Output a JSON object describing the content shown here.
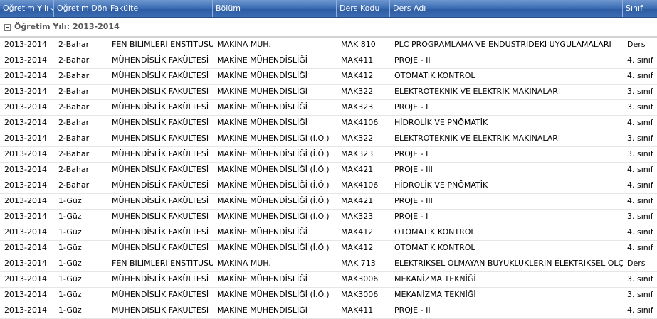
{
  "columns": [
    "Öğretim Yılı",
    "Öğretim Döne",
    "Fakülte",
    "Bölüm",
    "Ders Kodu",
    "Ders Adı",
    "Sınıf"
  ],
  "group_label": "Öğretim Yılı: 2013-2014",
  "rows": [
    [
      "2013-2014",
      "2-Bahar",
      "FEN BİLİMLERİ ENSTİTÜSÜ",
      "MAKİNA MÜH.",
      "MAK 810",
      "PLC PROGRAMLAMA VE ENDÜSTRİDEKİ UYGULAMALARI",
      "Ders"
    ],
    [
      "2013-2014",
      "2-Bahar",
      "MÜHENDİSLİK FAKÜLTESİ",
      "MAKİNE MÜHENDİSLİĞİ",
      "MAK411",
      "PROJE - II",
      "4. sınıf"
    ],
    [
      "2013-2014",
      "2-Bahar",
      "MÜHENDİSLİK FAKÜLTESİ",
      "MAKİNE MÜHENDİSLİĞİ",
      "MAK412",
      "OTOMATİK KONTROL",
      "4. sınıf"
    ],
    [
      "2013-2014",
      "2-Bahar",
      "MÜHENDİSLİK FAKÜLTESİ",
      "MAKİNE MÜHENDİSLİĞİ",
      "MAK322",
      "ELEKTROTEKNİK VE ELEKTRİK MAKİNALARI",
      "3. sınıf"
    ],
    [
      "2013-2014",
      "2-Bahar",
      "MÜHENDİSLİK FAKÜLTESİ",
      "MAKİNE MÜHENDİSLİĞİ",
      "MAK323",
      "PROJE - I",
      "3. sınıf"
    ],
    [
      "2013-2014",
      "2-Bahar",
      "MÜHENDİSLİK FAKÜLTESİ",
      "MAKİNE MÜHENDİSLİĞİ",
      "MAK4106",
      "HİDROLİK VE PNÖMATİK",
      "4. sınıf"
    ],
    [
      "2013-2014",
      "2-Bahar",
      "MÜHENDİSLİK FAKÜLTESİ",
      "MAKİNE MÜHENDİSLİĞİ (İ.Ö.)",
      "MAK322",
      "ELEKTROTEKNİK VE ELEKTRİK MAKİNALARI",
      "3. sınıf"
    ],
    [
      "2013-2014",
      "2-Bahar",
      "MÜHENDİSLİK FAKÜLTESİ",
      "MAKİNE MÜHENDİSLİĞİ (İ.Ö.)",
      "MAK323",
      "PROJE - I",
      "3. sınıf"
    ],
    [
      "2013-2014",
      "2-Bahar",
      "MÜHENDİSLİK FAKÜLTESİ",
      "MAKİNE MÜHENDİSLİĞİ (İ.Ö.)",
      "MAK421",
      "PROJE - III",
      "4. sınıf"
    ],
    [
      "2013-2014",
      "2-Bahar",
      "MÜHENDİSLİK FAKÜLTESİ",
      "MAKİNE MÜHENDİSLİĞİ (İ.Ö.)",
      "MAK4106",
      "HİDROLİK VE PNÖMATİK",
      "4. sınıf"
    ],
    [
      "2013-2014",
      "1-Güz",
      "MÜHENDİSLİK FAKÜLTESİ",
      "MAKİNE MÜHENDİSLİĞİ (İ.Ö.)",
      "MAK421",
      "PROJE - III",
      "4. sınıf"
    ],
    [
      "2013-2014",
      "1-Güz",
      "MÜHENDİSLİK FAKÜLTESİ",
      "MAKİNE MÜHENDİSLİĞİ (İ.Ö.)",
      "MAK323",
      "PROJE - I",
      "3. sınıf"
    ],
    [
      "2013-2014",
      "1-Güz",
      "MÜHENDİSLİK FAKÜLTESİ",
      "MAKİNE MÜHENDİSLİĞİ",
      "MAK412",
      "OTOMATİK KONTROL",
      "4. sınıf"
    ],
    [
      "2013-2014",
      "1-Güz",
      "MÜHENDİSLİK FAKÜLTESİ",
      "MAKİNE MÜHENDİSLİĞİ (İ.Ö.)",
      "MAK412",
      "OTOMATİK KONTROL",
      "4. sınıf"
    ],
    [
      "2013-2014",
      "1-Güz",
      "FEN BİLİMLERİ ENSTİTÜSÜ",
      "MAKİNA MÜH.",
      "MAK 713",
      "ELEKTRİKSEL OLMAYAN BÜYÜKLÜKLERİN ELEKTRİKSEL ÖLÇÜLMESİ",
      "Ders"
    ],
    [
      "2013-2014",
      "1-Güz",
      "MÜHENDİSLİK FAKÜLTESİ",
      "MAKİNE MÜHENDİSLİĞİ",
      "MAK3006",
      "MEKANİZMA TEKNİĞİ",
      "3. sınıf"
    ],
    [
      "2013-2014",
      "1-Güz",
      "MÜHENDİSLİK FAKÜLTESİ",
      "MAKİNE MÜHENDİSLİĞİ (İ.Ö.)",
      "MAK3006",
      "MEKANİZMA TEKNİĞİ",
      "3. sınıf"
    ],
    [
      "2013-2014",
      "1-Güz",
      "MÜHENDİSLİK FAKÜLTESİ",
      "MAKİNE MÜHENDİSLİĞİ",
      "MAK411",
      "PROJE - II",
      "4. sınıf"
    ]
  ]
}
